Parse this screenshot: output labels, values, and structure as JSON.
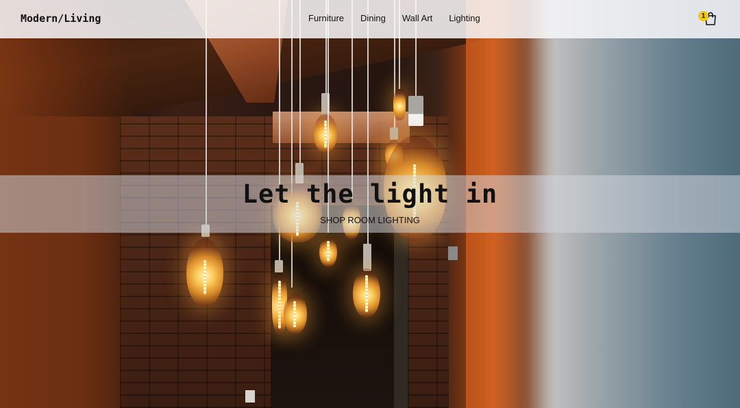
{
  "brand": {
    "name": "Modern/Living"
  },
  "nav": {
    "items": [
      {
        "label": "Furniture"
      },
      {
        "label": "Dining"
      },
      {
        "label": "Wall Art"
      },
      {
        "label": "Lighting"
      }
    ]
  },
  "cart": {
    "count": "1",
    "icon": "shopping-bag-icon",
    "badge_color": "#f5c518"
  },
  "hero": {
    "title": "Let the light in",
    "cta_label": "SHOP ROOM LIGHTING"
  }
}
